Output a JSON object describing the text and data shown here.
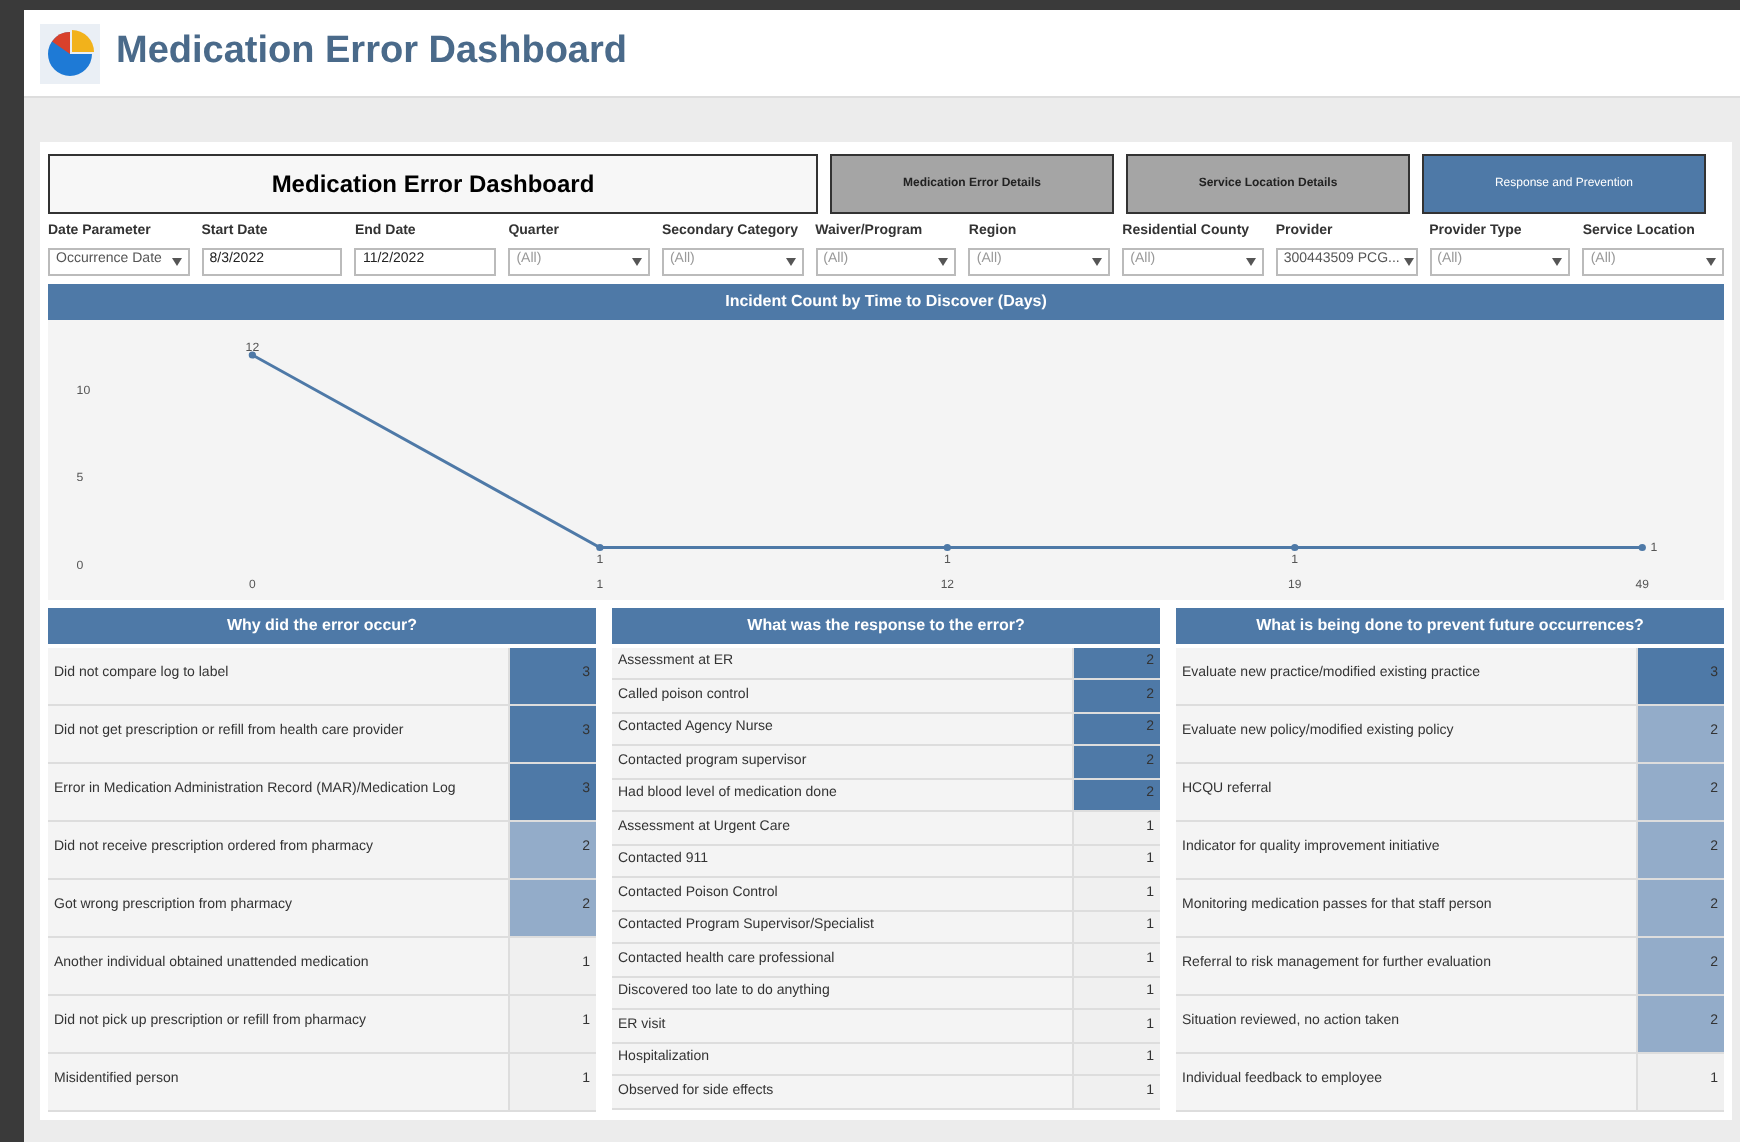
{
  "header": {
    "title": "Medication Error Dashboard"
  },
  "dashboard_title": "Medication Error Dashboard",
  "nav_buttons": [
    {
      "label": "Medication Error Details",
      "selected": false
    },
    {
      "label": "Service Location Details",
      "selected": false
    },
    {
      "label": "Response and Prevention",
      "selected": true
    }
  ],
  "filters": [
    {
      "label": "Date Parameter",
      "value": "Occurrence Date",
      "kind": "dropdown"
    },
    {
      "label": "Start Date",
      "value": "8/3/2022",
      "kind": "date"
    },
    {
      "label": "End Date",
      "value": "11/2/2022",
      "kind": "date"
    },
    {
      "label": "Quarter",
      "value": "(All)",
      "kind": "dropdown"
    },
    {
      "label": "Secondary Category",
      "value": "(All)",
      "kind": "dropdown"
    },
    {
      "label": "Waiver/Program",
      "value": "(All)",
      "kind": "dropdown"
    },
    {
      "label": "Region",
      "value": "(All)",
      "kind": "dropdown"
    },
    {
      "label": "Residential County",
      "value": "(All)",
      "kind": "dropdown"
    },
    {
      "label": "Provider",
      "value": "300443509 PCG...",
      "kind": "dropdown"
    },
    {
      "label": "Provider Type",
      "value": "(All)",
      "kind": "dropdown"
    },
    {
      "label": "Service Location",
      "value": "(All)",
      "kind": "dropdown"
    }
  ],
  "chart": {
    "title": "Incident Count by Time to Discover (Days)",
    "chart_data": {
      "type": "line",
      "categories": [
        "0",
        "1",
        "12",
        "19",
        "49"
      ],
      "series": [
        {
          "color": "#4e79a7",
          "marker": "circle",
          "values": [
            12,
            1,
            1,
            1,
            1
          ]
        }
      ],
      "ylim": [
        -2,
        14
      ],
      "yticks": [
        0,
        5,
        10
      ],
      "data_labels": true
    }
  },
  "tables": [
    {
      "title": "Why did the error occur?",
      "rows": [
        {
          "label": "Did not compare log to label",
          "value": "3",
          "kind": "high"
        },
        {
          "label": "Did not get prescription or refill from health care provider",
          "value": "3",
          "kind": "high"
        },
        {
          "label": "Error in Medication Administration Record (MAR)/Medication Log",
          "value": "3",
          "kind": "high"
        },
        {
          "label": "Did not receive prescription ordered from pharmacy",
          "value": "2",
          "kind": "mid"
        },
        {
          "label": "Got wrong prescription from pharmacy",
          "value": "2",
          "kind": "mid"
        },
        {
          "label": "Another individual obtained unattended medication",
          "value": "1",
          "kind": "low"
        },
        {
          "label": "Did not pick up prescription or refill from pharmacy",
          "value": "1",
          "kind": "low"
        },
        {
          "label": "Misidentified person",
          "value": "1",
          "kind": "low"
        }
      ]
    },
    {
      "title": "What was the response to the error?",
      "rows": [
        {
          "label": "Assessment at ER",
          "value": "2",
          "kind": "high"
        },
        {
          "label": "Called poison control",
          "value": "2",
          "kind": "high"
        },
        {
          "label": "Contacted Agency Nurse",
          "value": "2",
          "kind": "high"
        },
        {
          "label": "Contacted program supervisor",
          "value": "2",
          "kind": "high"
        },
        {
          "label": "Had blood level of medication done",
          "value": "2",
          "kind": "high"
        },
        {
          "label": "Assessment at Urgent Care",
          "value": "1",
          "kind": "low"
        },
        {
          "label": "Contacted 911",
          "value": "1",
          "kind": "low"
        },
        {
          "label": "Contacted Poison Control",
          "value": "1",
          "kind": "low"
        },
        {
          "label": "Contacted Program Supervisor/Specialist",
          "value": "1",
          "kind": "low"
        },
        {
          "label": "Contacted health care professional",
          "value": "1",
          "kind": "low"
        },
        {
          "label": "Discovered too late to do anything",
          "value": "1",
          "kind": "low"
        },
        {
          "label": "ER visit",
          "value": "1",
          "kind": "low"
        },
        {
          "label": "Hospitalization",
          "value": "1",
          "kind": "low"
        },
        {
          "label": "Observed for side effects",
          "value": "1",
          "kind": "low"
        }
      ]
    },
    {
      "title": "What is being done to prevent future occurrences?",
      "rows": [
        {
          "label": "Evaluate new practice/modified existing practice",
          "value": "3",
          "kind": "high"
        },
        {
          "label": "Evaluate new policy/modified existing policy",
          "value": "2",
          "kind": "mid"
        },
        {
          "label": "HCQU referral",
          "value": "2",
          "kind": "mid"
        },
        {
          "label": "Indicator for quality improvement initiative",
          "value": "2",
          "kind": "mid"
        },
        {
          "label": "Monitoring medication passes for that staff person",
          "value": "2",
          "kind": "mid"
        },
        {
          "label": "Referral to risk management for further evaluation",
          "value": "2",
          "kind": "mid"
        },
        {
          "label": "Situation reviewed, no action taken",
          "value": "2",
          "kind": "mid"
        },
        {
          "label": "Individual feedback to employee",
          "value": "1",
          "kind": "low"
        }
      ]
    }
  ]
}
